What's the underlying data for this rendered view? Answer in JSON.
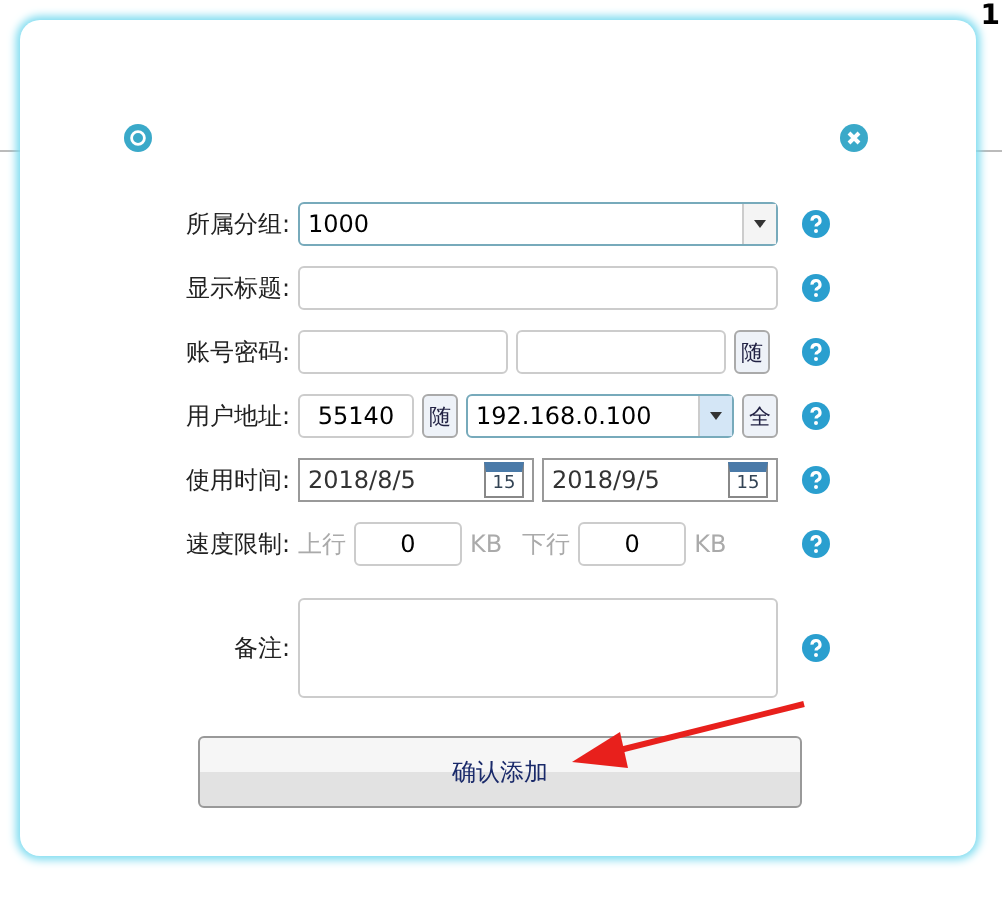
{
  "corner_text": "1",
  "dialog": {
    "rows": [
      {
        "kind": "select",
        "label": "所属分组:",
        "value": "1000"
      },
      {
        "kind": "text",
        "label": "显示标题:",
        "value": ""
      },
      {
        "kind": "pair",
        "label": "账号密码:",
        "button": "随"
      },
      {
        "kind": "address",
        "label": "用户地址:",
        "port": "55140",
        "button": "随",
        "value": "192.168.0.100",
        "button2": "全"
      },
      {
        "kind": "dates",
        "label": "使用时间:",
        "start": "2018/8/5",
        "end": "2018/9/5",
        "start_day": "15",
        "end_day": "15"
      },
      {
        "kind": "speed",
        "label": "速度限制:",
        "up_label": "上行",
        "up": "0",
        "down_label": "下行",
        "down": "0",
        "up_unit": "KB",
        "down_unit": "KB"
      },
      {
        "kind": "textarea",
        "label": "备注:"
      }
    ],
    "submit": "确认添加"
  }
}
